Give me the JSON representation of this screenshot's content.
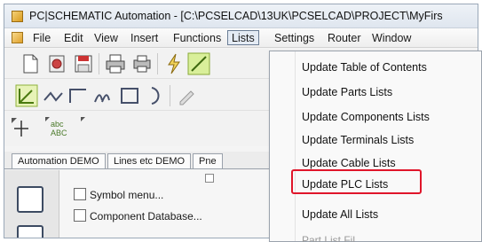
{
  "window": {
    "title": "PC|SCHEMATIC Automation - [C:\\PCSELCAD\\13UK\\PCSELCAD\\PROJECT\\MyFirs"
  },
  "menubar": {
    "items": [
      {
        "label": "File"
      },
      {
        "label": "Edit"
      },
      {
        "label": "View"
      },
      {
        "label": "Insert"
      },
      {
        "label": "Functions"
      },
      {
        "label": "Lists"
      },
      {
        "label": "Settings"
      },
      {
        "label": "Router"
      },
      {
        "label": "Window"
      }
    ],
    "active": "Lists"
  },
  "lists_menu": {
    "items": [
      {
        "label": "Update Table of Contents"
      },
      {
        "label": "Update Parts Lists"
      },
      {
        "label": "Update Components Lists"
      },
      {
        "label": "Update Terminals Lists"
      },
      {
        "label": "Update Cable Lists"
      },
      {
        "label": "Update PLC Lists"
      },
      {
        "label": "Update All Lists"
      }
    ],
    "highlighted": "Update PLC Lists",
    "highlight_color": "#e0152a",
    "partial_item": "Part List Fil..."
  },
  "toolbar": {
    "text_tool_label": "abc\nABC"
  },
  "tabs": [
    {
      "label": "Automation DEMO"
    },
    {
      "label": "Lines etc DEMO"
    },
    {
      "label": "Pne"
    }
  ],
  "side_panel": {
    "items": [
      {
        "label": "Symbol menu...",
        "icon": "symbol-menu-icon"
      },
      {
        "label": "Component Database...",
        "icon": "database-icon"
      }
    ]
  }
}
